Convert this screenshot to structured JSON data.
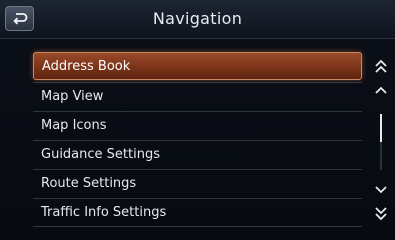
{
  "header": {
    "title": "Navigation"
  },
  "menu": {
    "items": [
      {
        "label": "Address Book"
      },
      {
        "label": "Map View"
      },
      {
        "label": "Map Icons"
      },
      {
        "label": "Guidance Settings"
      },
      {
        "label": "Route Settings"
      },
      {
        "label": "Traffic Info Settings"
      }
    ],
    "selected_index": 0
  },
  "scrollbar": {
    "position": 0,
    "icons": {
      "page_up": "double-chevron-up-icon",
      "line_up": "chevron-up-icon",
      "line_down": "chevron-down-icon",
      "page_down": "double-chevron-down-icon"
    }
  },
  "colors": {
    "selection": "#7b3419",
    "selection_border": "#c9875f",
    "text": "#e6e9ee",
    "background": "#0a0d14"
  }
}
